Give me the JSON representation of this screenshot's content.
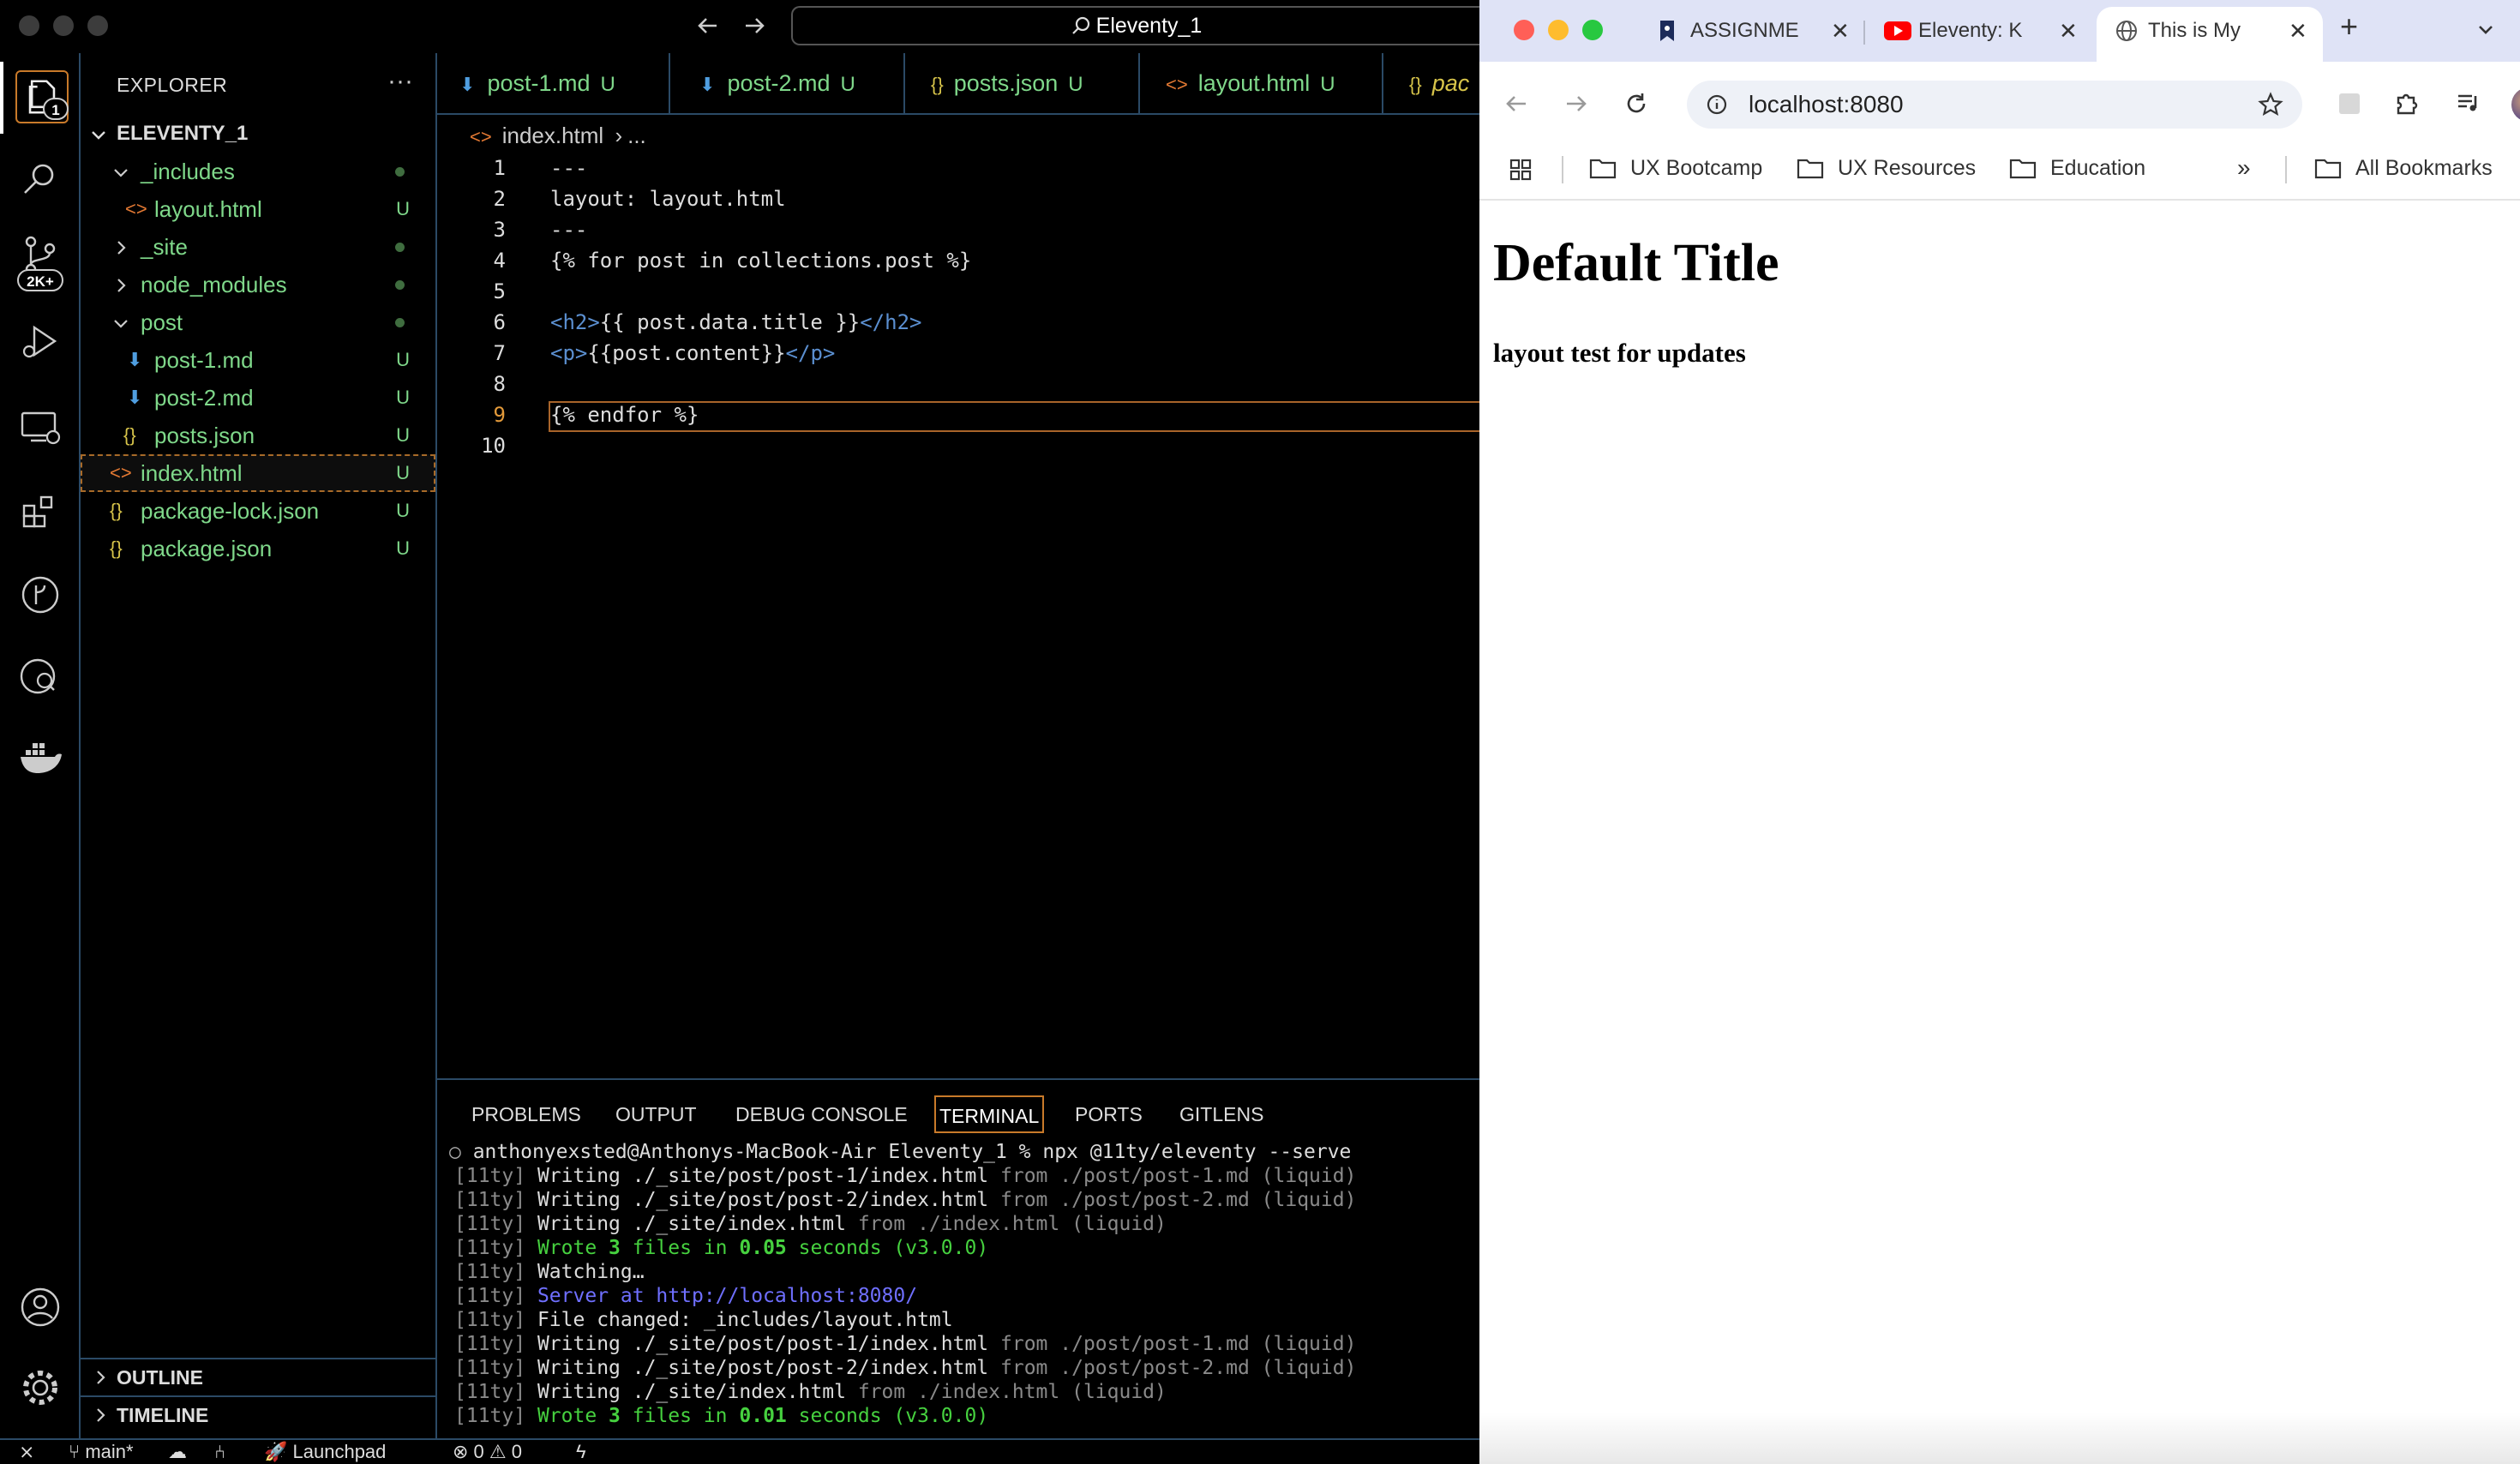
{
  "vscode": {
    "command_center": "Eleventy_1",
    "activity": {
      "explorer_badge": "1",
      "scm_badge": "2K+"
    },
    "explorer": {
      "title": "EXPLORER",
      "more": "···",
      "project": "ELEVENTY_1",
      "tree": [
        {
          "label": "_includes",
          "status": ""
        },
        {
          "label": "layout.html",
          "status": "U"
        },
        {
          "label": "_site",
          "status": ""
        },
        {
          "label": "node_modules",
          "status": ""
        },
        {
          "label": "post",
          "status": ""
        },
        {
          "label": "post-1.md",
          "status": "U"
        },
        {
          "label": "post-2.md",
          "status": "U"
        },
        {
          "label": "posts.json",
          "status": "U"
        },
        {
          "label": "index.html",
          "status": "U"
        },
        {
          "label": "package-lock.json",
          "status": "U"
        },
        {
          "label": "package.json",
          "status": "U"
        }
      ],
      "outline": "OUTLINE",
      "timeline": "TIMELINE"
    },
    "tabs": [
      {
        "label": "post-1.md",
        "status": "U"
      },
      {
        "label": "post-2.md",
        "status": "U"
      },
      {
        "label": "posts.json",
        "status": "U"
      },
      {
        "label": "layout.html",
        "status": "U"
      },
      {
        "label": "pac"
      }
    ],
    "breadcrumb": {
      "file": "index.html",
      "sep": "›",
      "rest": "..."
    },
    "code": {
      "line_numbers": [
        "1",
        "2",
        "3",
        "4",
        "5",
        "6",
        "7",
        "8",
        "9",
        "10"
      ],
      "l1": "---",
      "l2": "layout: layout.html",
      "l3": "---",
      "l4": "{% for post in collections.post %}",
      "l6_open": "<h2>",
      "l6_text": "{{ post.data.title }}",
      "l6_close": "</h2>",
      "l7_open": "<p>",
      "l7_text": "{{post.content}}",
      "l7_close": "</p>",
      "l9": "{% endfor %}"
    },
    "panel": {
      "tabs": [
        "PROBLEMS",
        "OUTPUT",
        "DEBUG CONSOLE",
        "TERMINAL",
        "PORTS",
        "GITLENS"
      ],
      "prompt": "anthonyexsted@Anthonys-MacBook-Air Eleventy_1 % npx @11ty/eleventy --serve",
      "tag": "[11ty]",
      "w1a": "Writing ./_site/post/post-1/index.html",
      "w1b": "from ./post/post-1.md (liquid)",
      "w2a": "Writing ./_site/post/post-2/index.html",
      "w2b": "from ./post/post-2.md (liquid)",
      "w3a": "Writing ./_site/index.html",
      "w3b": "from ./index.html (liquid)",
      "wrote1_a": "Wrote ",
      "wrote1_n": "3",
      "wrote1_b": " files in ",
      "wrote1_t": "0.05",
      "wrote1_c": " seconds (v3.0.0)",
      "watching": "Watching…",
      "server": "Server at http://localhost:8080/",
      "changed": "File changed: _includes/layout.html",
      "wrote2_a": "Wrote ",
      "wrote2_n": "3",
      "wrote2_b": " files in ",
      "wrote2_t": "0.01",
      "wrote2_c": " seconds (v3.0.0)"
    },
    "status": {
      "branch": "main*",
      "launchpad": "Launchpad",
      "errors": "0",
      "warnings": "0"
    }
  },
  "chrome": {
    "tabs": [
      {
        "title": "ASSIGNME"
      },
      {
        "title": "Eleventy: K"
      },
      {
        "title": "This is My"
      }
    ],
    "url": "localhost:8080",
    "bookmarks": [
      "UX Bootcamp",
      "UX Resources",
      "Education"
    ],
    "all_bookmarks": "All Bookmarks",
    "page": {
      "h1": "Default Title",
      "h2": "layout test for updates"
    }
  }
}
